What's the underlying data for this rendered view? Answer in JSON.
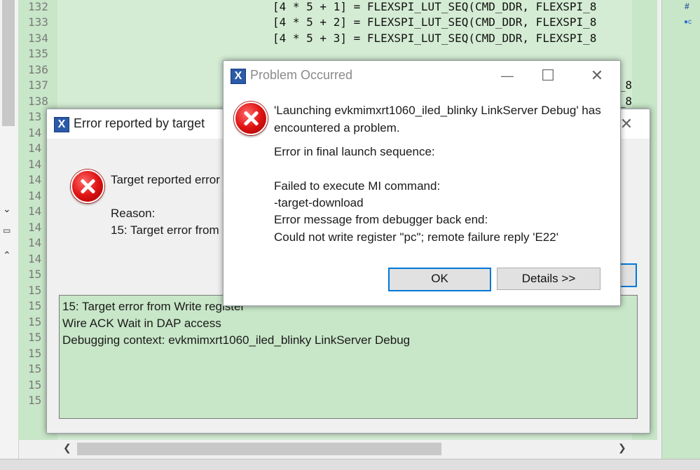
{
  "editor": {
    "line_numbers": [
      "132",
      "133",
      "134",
      "135",
      "136",
      "137",
      "138",
      "13",
      "14",
      "14",
      "14",
      "14",
      "14",
      "14",
      "14",
      "14",
      "14",
      "15",
      "15",
      "15",
      "15",
      "15",
      "15",
      "15",
      "15",
      "15"
    ],
    "code_lines": [
      "[4 * 5 + 1] = FLEXSPI_LUT_SEQ(CMD_DDR, FLEXSPI_8",
      "[4 * 5 + 2] = FLEXSPI_LUT_SEQ(CMD_DDR, FLEXSPI_8",
      "[4 * 5 + 3] = FLEXSPI_LUT_SEQ(CMD_DDR, FLEXSPI_8"
    ],
    "code_edges": [
      "_8",
      "_8"
    ],
    "right_pane": {
      "hash": "#",
      "dot": "●c"
    }
  },
  "error_target_dialog": {
    "title": "Error reported by target",
    "close_glyph": "✕",
    "message": "Target reported error",
    "reason_label": "Reason:",
    "reason": "15: Target error from",
    "details": [
      "15: Target error from Write register",
      "Wire ACK Wait in DAP access",
      "Debugging context: evkmimxrt1060_iled_blinky LinkServer Debug"
    ]
  },
  "problem_dialog": {
    "title": "Problem Occurred",
    "app_icon_glyph": "X",
    "minimize_glyph": "—",
    "maximize_glyph": "☐",
    "close_glyph": "✕",
    "message_line1": "'Launching evkmimxrt1060_iled_blinky LinkServer Debug' has",
    "message_line2": "encountered a problem.",
    "error_heading": "Error in final launch sequence:",
    "detail_lines": [
      "Failed to execute MI command:",
      "-target-download",
      "Error message from debugger back end:",
      "Could not write register \"pc\"; remote failure reply 'E22'"
    ],
    "ok_label": "OK",
    "details_label": "Details >>"
  },
  "colors": {
    "editor_bg": "#c8e6c8",
    "accent": "#0078d7",
    "error_red": "#e01414"
  }
}
